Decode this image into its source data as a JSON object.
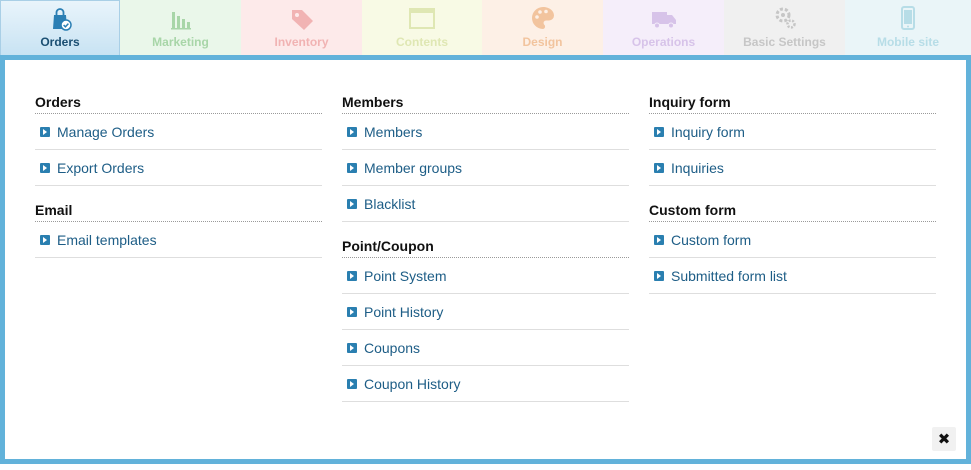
{
  "tabs": [
    {
      "label": "Orders",
      "icon": "shopping-bag-icon",
      "bg": "",
      "fg": "#1b4f72",
      "active": true
    },
    {
      "label": "Marketing",
      "icon": "bar-chart-icon",
      "bg": "#eaf7ea",
      "fg": "#a8d6a8",
      "active": false
    },
    {
      "label": "Inventory",
      "icon": "price-tag-icon",
      "bg": "#fdeaea",
      "fg": "#f1b3b3",
      "active": false
    },
    {
      "label": "Contents",
      "icon": "window-icon",
      "bg": "#f8fae5",
      "fg": "#dfe7b3",
      "active": false
    },
    {
      "label": "Design",
      "icon": "palette-icon",
      "bg": "#fdf0e6",
      "fg": "#f2c49e",
      "active": false
    },
    {
      "label": "Operations",
      "icon": "truck-icon",
      "bg": "#f5eefa",
      "fg": "#d7c3e9",
      "active": false
    },
    {
      "label": "Basic Settings",
      "icon": "gears-icon",
      "bg": "#f0f0f0",
      "fg": "#c6c6c6",
      "active": false
    },
    {
      "label": "Mobile site",
      "icon": "smartphone-icon",
      "bg": "#eaf5f8",
      "fg": "#b7dde7",
      "active": false
    }
  ],
  "columns": [
    {
      "groups": [
        {
          "title": "Orders",
          "items": [
            "Manage Orders",
            "Export Orders"
          ]
        },
        {
          "title": "Email",
          "items": [
            "Email templates"
          ]
        }
      ]
    },
    {
      "groups": [
        {
          "title": "Members",
          "items": [
            "Members",
            "Member groups",
            "Blacklist"
          ]
        },
        {
          "title": "Point/Coupon",
          "items": [
            "Point System",
            "Point History",
            "Coupons",
            "Coupon History"
          ]
        }
      ]
    },
    {
      "groups": [
        {
          "title": "Inquiry form",
          "items": [
            "Inquiry form",
            "Inquiries"
          ]
        },
        {
          "title": "Custom form",
          "items": [
            "Custom form",
            "Submitted form list"
          ]
        }
      ]
    }
  ],
  "close": {
    "glyph": "✖"
  },
  "colors": {
    "panel_border": "#62b2da",
    "link": "#1d5d86",
    "bullet": "#2a7fb0"
  }
}
